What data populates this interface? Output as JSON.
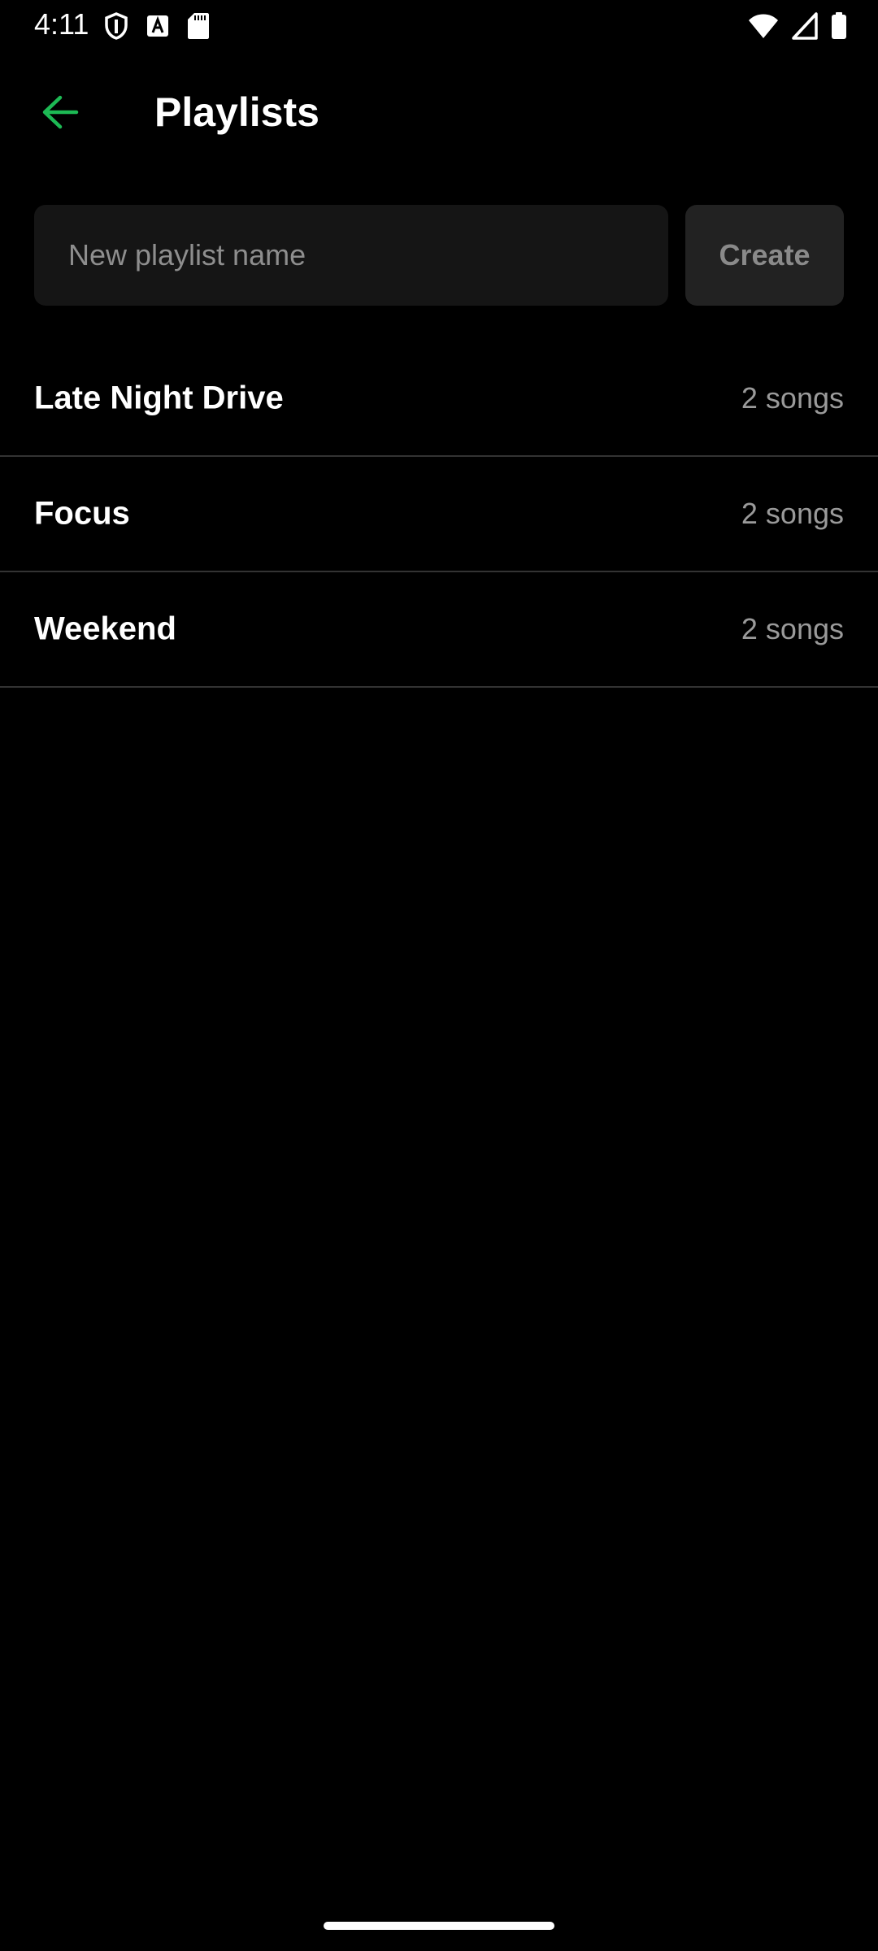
{
  "status_bar": {
    "time": "4:11",
    "left_icons": [
      "shield-icon",
      "text-a-icon",
      "sd-card-icon"
    ],
    "right_icons": [
      "wifi-icon",
      "cell-signal-icon",
      "battery-icon"
    ]
  },
  "app_bar": {
    "title": "Playlists",
    "back_icon": "arrow-back-icon",
    "accent_color": "#1DB954"
  },
  "new_playlist": {
    "value": "",
    "placeholder": "New playlist name",
    "create_label": "Create"
  },
  "playlists": [
    {
      "name": "Late Night Drive",
      "count": "2 songs"
    },
    {
      "name": "Focus",
      "count": "2 songs"
    },
    {
      "name": "Weekend",
      "count": "2 songs"
    }
  ],
  "colors": {
    "background": "#000000",
    "input_background": "#151515",
    "button_background": "#222222",
    "divider": "#333333",
    "secondary_text": "#9a9a9a"
  }
}
